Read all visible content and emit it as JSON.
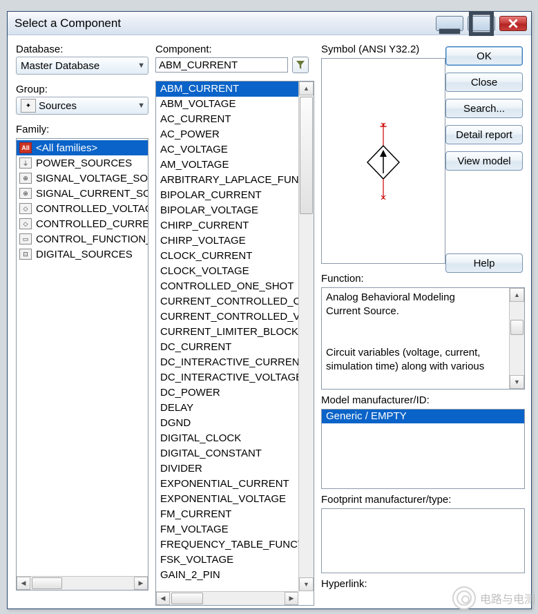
{
  "window": {
    "title": "Select a Component"
  },
  "labels": {
    "database": "Database:",
    "group": "Group:",
    "family": "Family:",
    "component": "Component:",
    "symbol": "Symbol (ANSI Y32.2)",
    "function": "Function:",
    "model": "Model manufacturer/ID:",
    "footprint": "Footprint manufacturer/type:",
    "hyperlink": "Hyperlink:"
  },
  "database": {
    "value": "Master Database"
  },
  "group": {
    "value": "Sources"
  },
  "family": {
    "selected_index": 0,
    "items": [
      {
        "name": "<All families>",
        "icon": "ALL"
      },
      {
        "name": "POWER_SOURCES",
        "icon": "⏚"
      },
      {
        "name": "SIGNAL_VOLTAGE_SOURCES",
        "icon": "⊕"
      },
      {
        "name": "SIGNAL_CURRENT_SOURCES",
        "icon": "⊕"
      },
      {
        "name": "CONTROLLED_VOLTAGE_SOURCES",
        "icon": "◇"
      },
      {
        "name": "CONTROLLED_CURRENT_SOURCES",
        "icon": "◇"
      },
      {
        "name": "CONTROL_FUNCTION_BLOCKS",
        "icon": "▭"
      },
      {
        "name": "DIGITAL_SOURCES",
        "icon": "⊡"
      }
    ]
  },
  "component": {
    "value": "ABM_CURRENT",
    "selected_index": 0,
    "items": [
      "ABM_CURRENT",
      "ABM_VOLTAGE",
      "AC_CURRENT",
      "AC_POWER",
      "AC_VOLTAGE",
      "AM_VOLTAGE",
      "ARBITRARY_LAPLACE_FUNCTION",
      "BIPOLAR_CURRENT",
      "BIPOLAR_VOLTAGE",
      "CHIRP_CURRENT",
      "CHIRP_VOLTAGE",
      "CLOCK_CURRENT",
      "CLOCK_VOLTAGE",
      "CONTROLLED_ONE_SHOT",
      "CURRENT_CONTROLLED_CURRENT_SOURCE",
      "CURRENT_CONTROLLED_VOLTAGE_SOURCE",
      "CURRENT_LIMITER_BLOCK",
      "DC_CURRENT",
      "DC_INTERACTIVE_CURRENT",
      "DC_INTERACTIVE_VOLTAGE",
      "DC_POWER",
      "DELAY",
      "DGND",
      "DIGITAL_CLOCK",
      "DIGITAL_CONSTANT",
      "DIVIDER",
      "EXPONENTIAL_CURRENT",
      "EXPONENTIAL_VOLTAGE",
      "FM_CURRENT",
      "FM_VOLTAGE",
      "FREQUENCY_TABLE_FUNCTION",
      "FSK_VOLTAGE",
      "GAIN_2_PIN"
    ]
  },
  "function_text_lines": [
    "Analog Behavioral Modeling",
    "Current Source.",
    "",
    "Circuit variables (voltage, current,",
    "simulation time) along with various"
  ],
  "model": {
    "items": [
      "Generic / EMPTY"
    ],
    "selected_index": 0
  },
  "buttons": {
    "ok": "OK",
    "close": "Close",
    "search": "Search...",
    "detail": "Detail report",
    "view": "View model",
    "help": "Help"
  },
  "watermark": "电路与电测"
}
